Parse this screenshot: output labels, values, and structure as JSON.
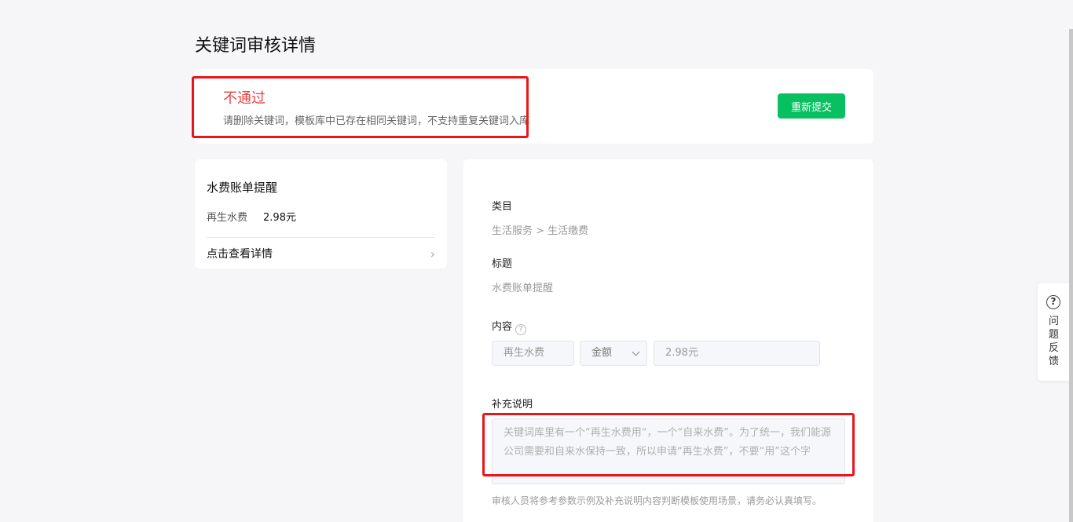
{
  "page": {
    "title": "关键词审核详情"
  },
  "status": {
    "title": "不通过",
    "reason": "请删除关键词，模板库中已存在相同关键词，不支持重复关键词入库",
    "resubmit_label": "重新提交"
  },
  "preview": {
    "title": "水费账单提醒",
    "row_key": "再生水费",
    "row_value": "2.98元",
    "link_label": "点击查看详情"
  },
  "details": {
    "category_label": "类目",
    "category_value": "生活服务 > 生活缴费",
    "title_label": "标题",
    "title_value": "水费账单提醒",
    "content_label": "内容",
    "content_keyword": "再生水费",
    "content_type": "金额",
    "content_example": "2.98元",
    "supplement_label": "补充说明",
    "supplement_text": "关键词库里有一个“再生水费用“，一个“自来水费”。为了统一，我们能源公司需要和自来水保持一致，所以申请“再生水费”，不要“用”这个字",
    "hint": "审核人员将参考参数示例及补充说明内容判断模板使用场景，请务必认真填写。"
  },
  "feedback": {
    "label": "问题反馈"
  },
  "colors": {
    "accent": "#07c160",
    "error": "#e64340",
    "highlight": "#e8161b"
  }
}
